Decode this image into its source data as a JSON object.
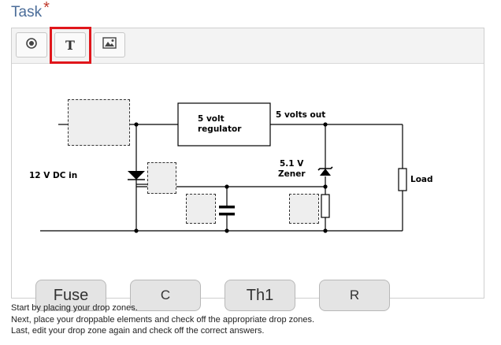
{
  "task": {
    "label": "Task",
    "required_mark": "*"
  },
  "toolbar": {
    "buttons": [
      {
        "icon": "target-icon"
      },
      {
        "label": "T",
        "icon": "text-icon"
      },
      {
        "icon": "image-icon"
      }
    ],
    "highlight_color": "#e0161b"
  },
  "circuit": {
    "input_label": "12 V DC in",
    "regulator_line1": "5 volt",
    "regulator_line2": "regulator",
    "output_label": "5 volts out",
    "zener_line1": "5.1 V",
    "zener_line2": "Zener",
    "load_label": "Load"
  },
  "drag_items": [
    "Fuse",
    "C",
    "Th1",
    "R"
  ],
  "instructions": [
    "Start by placing your drop zones.",
    "Next, place your droppable elements and check off the appropriate drop zones.",
    "Last, edit your drop zone again and check off the correct answers."
  ]
}
